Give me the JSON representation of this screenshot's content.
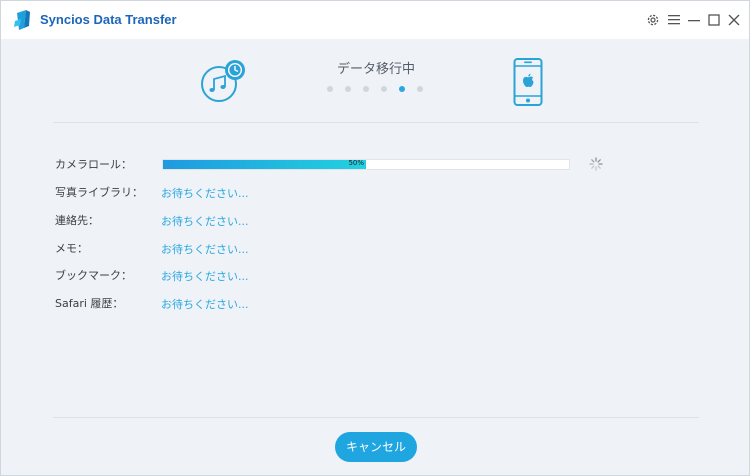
{
  "app": {
    "title": "Syncios Data Transfer"
  },
  "window_controls": [
    "gear-icon",
    "menu-icon",
    "minimize-icon",
    "maximize-icon",
    "close-icon"
  ],
  "transfer": {
    "status": "データ移行中",
    "step_total": 6,
    "step_active": 5,
    "source_icon": "itunes-backup-icon",
    "target_icon": "iphone-icon"
  },
  "items": [
    {
      "label": "カメラロール：",
      "progress_percent": 50,
      "progress_text": "50%"
    },
    {
      "label": "写真ライブラリ：",
      "status": "お待ちください..."
    },
    {
      "label": "連絡先：",
      "status": "お待ちください..."
    },
    {
      "label": "メモ：",
      "status": "お待ちください..."
    },
    {
      "label": "ブックマーク：",
      "status": "お待ちください..."
    },
    {
      "label": "Safari 履歴：",
      "status": "お待ちください..."
    }
  ],
  "cancel_label": "キャンセル",
  "colors": {
    "accent": "#29a8e0",
    "title": "#1c66b8",
    "background": "#eff2f7"
  }
}
